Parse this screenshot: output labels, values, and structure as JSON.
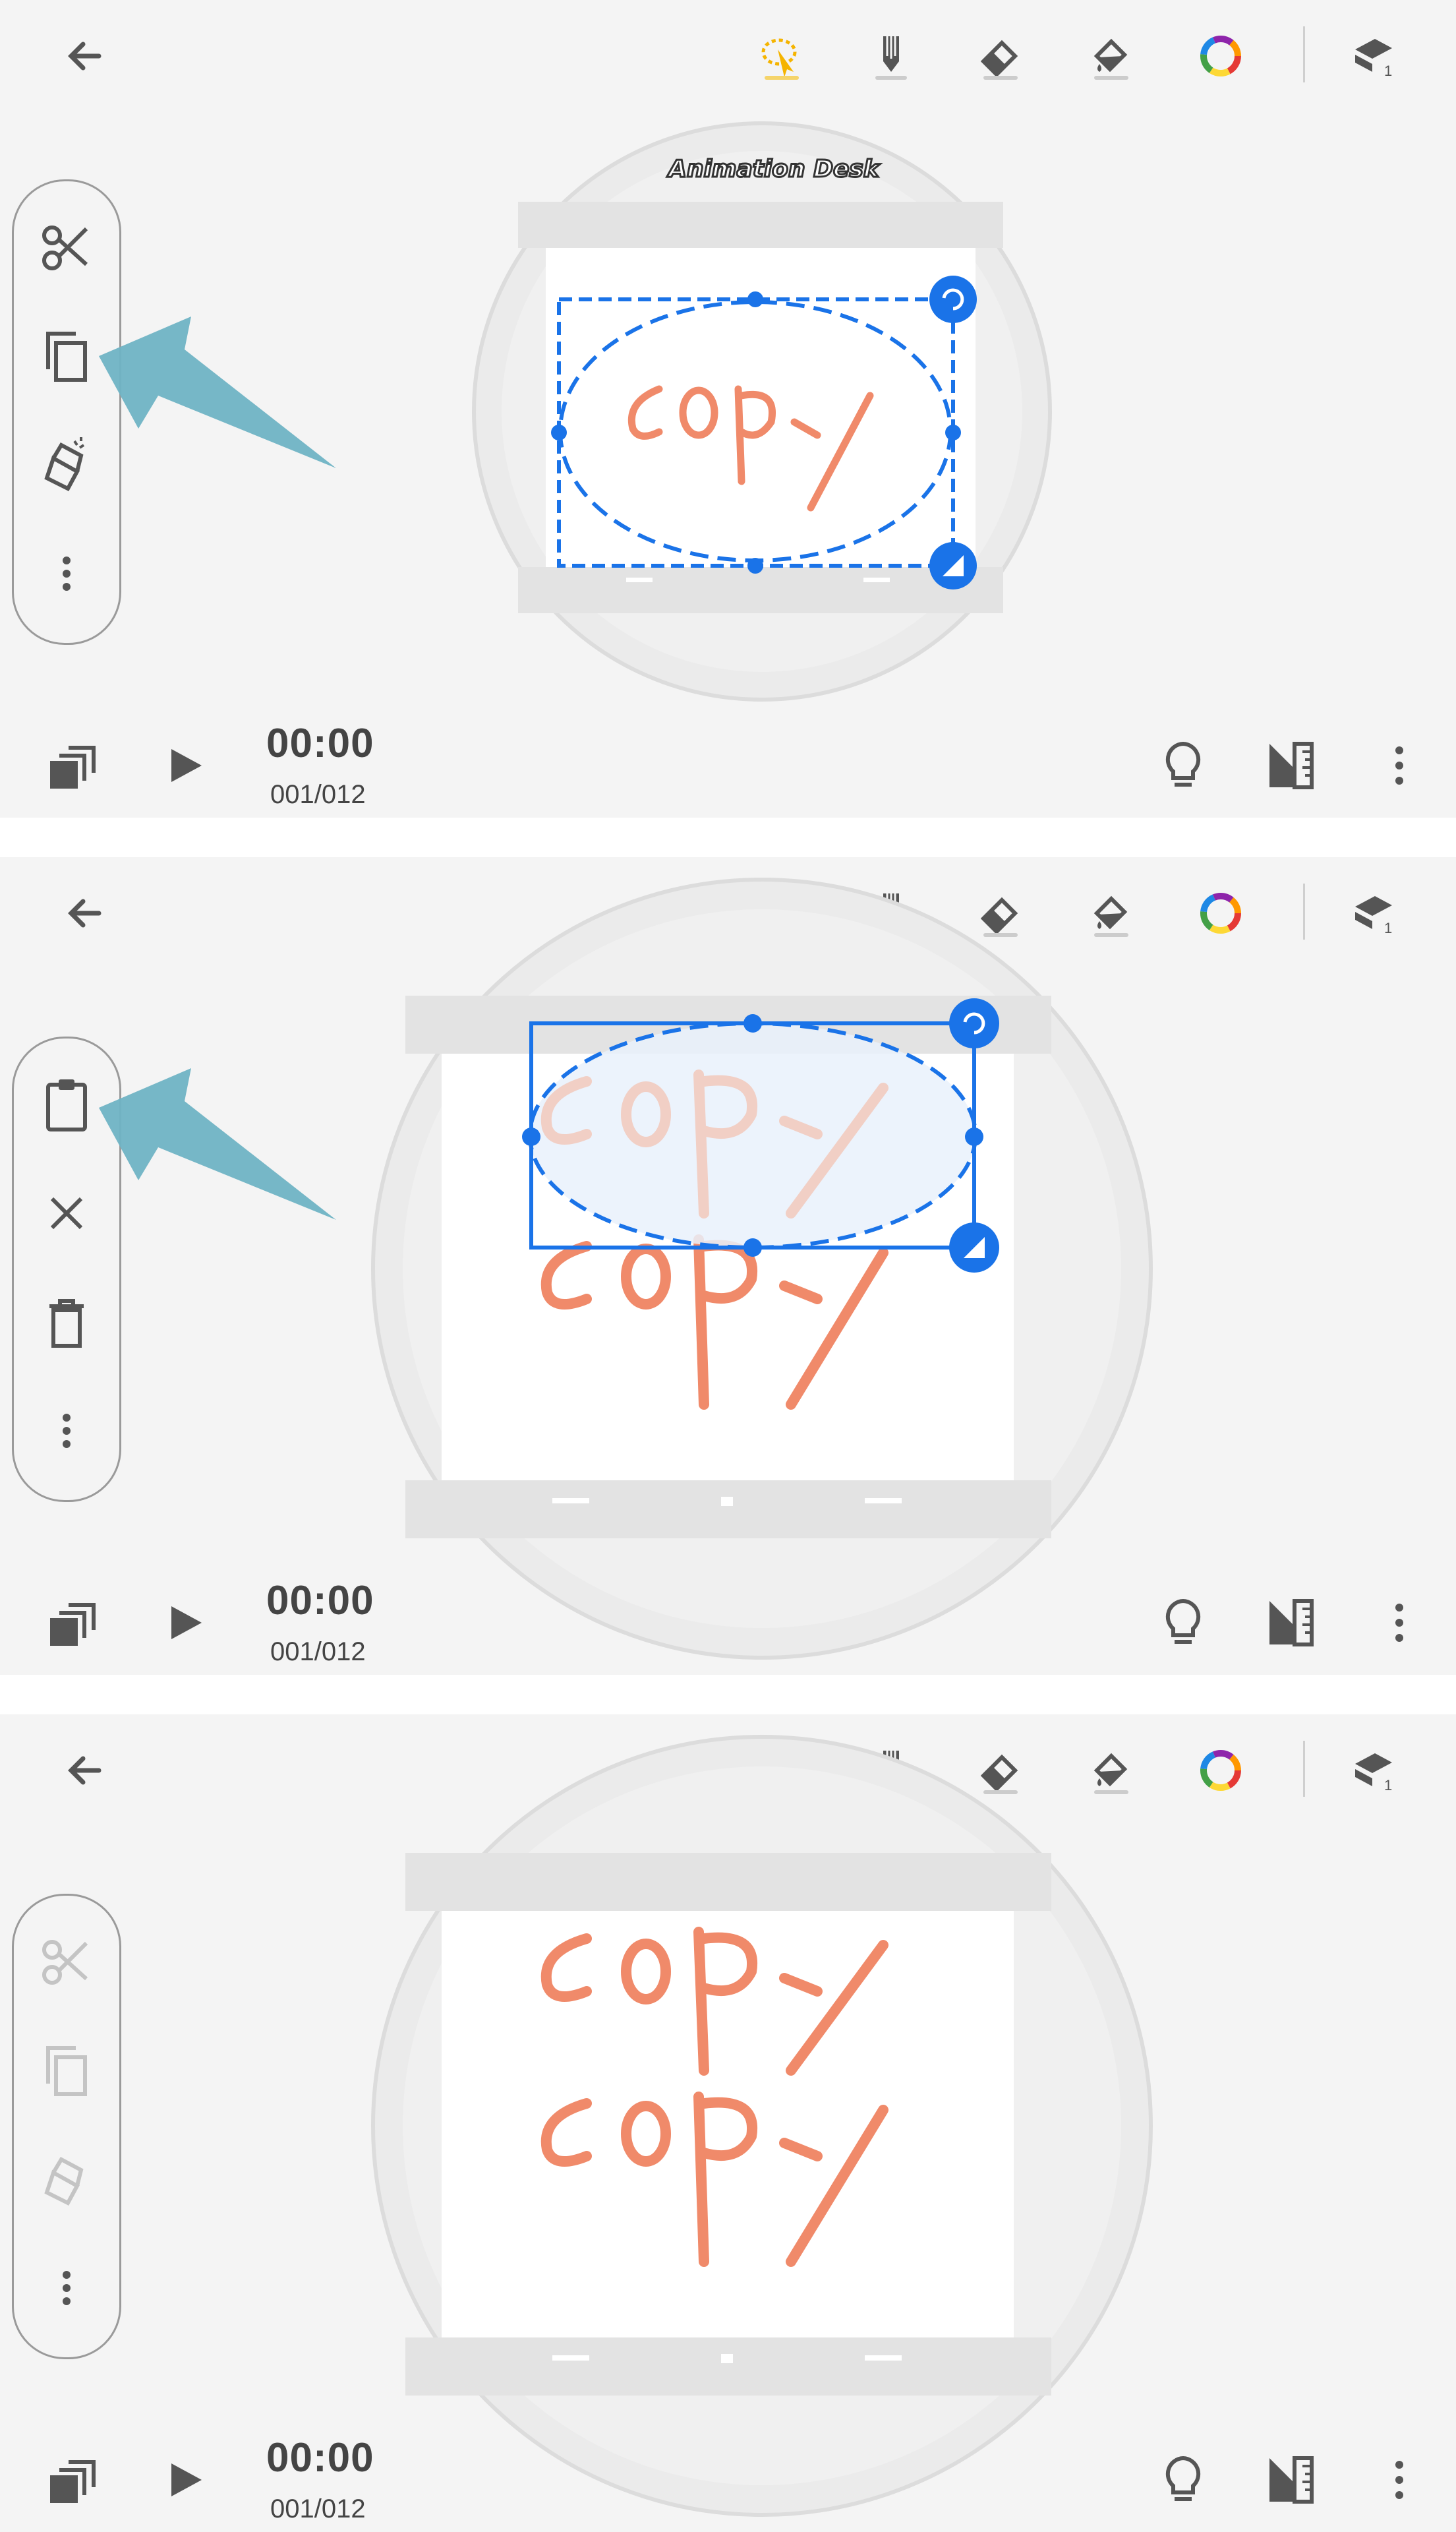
{
  "app": {
    "logo_text": "Animation Desk"
  },
  "toolbar": {
    "back_icon": "arrow-left-icon",
    "tools": [
      "lasso-select-icon",
      "pencil-icon",
      "eraser-icon",
      "paint-bucket-icon",
      "color-wheel-icon",
      "layers-icon"
    ],
    "active_tool_color": "#f5b400",
    "layer_number": "1"
  },
  "panels": [
    {
      "side_menu": [
        "cut-icon",
        "copy-icon",
        "clear-icon",
        "more-vertical-icon"
      ],
      "time": "00:00",
      "frame": "001/012",
      "canvas_text": [
        "copy"
      ],
      "annotation": "arrow pointing to copy-icon"
    },
    {
      "side_menu": [
        "paste-icon",
        "close-icon",
        "delete-icon",
        "more-vertical-icon"
      ],
      "time": "00:00",
      "frame": "001/012",
      "canvas_text": [
        "copy",
        "copy"
      ],
      "annotation": "arrow pointing to paste-icon"
    },
    {
      "side_menu": [
        "cut-icon",
        "copy-icon",
        "clear-icon",
        "more-vertical-icon"
      ],
      "side_menu_state": "disabled",
      "time": "00:00",
      "frame": "001/012",
      "canvas_text": [
        "copy",
        "copy"
      ]
    }
  ],
  "colors": {
    "selection": "#1a73e8",
    "pointer_arrow": "#6fb3c4",
    "stroke": "#f08a6a"
  }
}
